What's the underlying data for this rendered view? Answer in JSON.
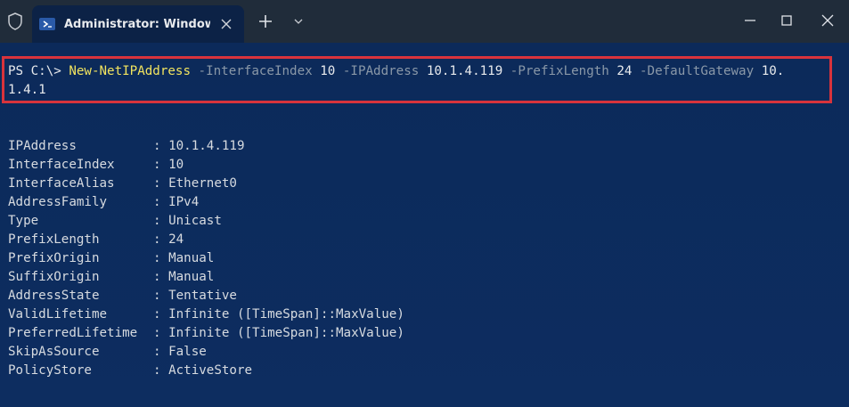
{
  "window": {
    "tab_title": "Administrator: Windows PowerShell"
  },
  "command": {
    "prompt": "PS C:\\> ",
    "cmdlet": "New-NetIPAddress",
    "param1": " -InterfaceIndex ",
    "val1": "10",
    "param2": " -IPAddress ",
    "val2": "10.1.4.119",
    "param3": " -PrefixLength ",
    "val3": "24",
    "param4": " -DefaultGateway ",
    "val4a": "10.",
    "val4b": "1.4.1"
  },
  "output": [
    {
      "key": "IPAddress",
      "value": "10.1.4.119"
    },
    {
      "key": "InterfaceIndex",
      "value": "10"
    },
    {
      "key": "InterfaceAlias",
      "value": "Ethernet0"
    },
    {
      "key": "AddressFamily",
      "value": "IPv4"
    },
    {
      "key": "Type",
      "value": "Unicast"
    },
    {
      "key": "PrefixLength",
      "value": "24"
    },
    {
      "key": "PrefixOrigin",
      "value": "Manual"
    },
    {
      "key": "SuffixOrigin",
      "value": "Manual"
    },
    {
      "key": "AddressState",
      "value": "Tentative"
    },
    {
      "key": "ValidLifetime",
      "value": "Infinite ([TimeSpan]::MaxValue)"
    },
    {
      "key": "PreferredLifetime",
      "value": "Infinite ([TimeSpan]::MaxValue)"
    },
    {
      "key": "SkipAsSource",
      "value": "False"
    },
    {
      "key": "PolicyStore",
      "value": "ActiveStore"
    }
  ]
}
